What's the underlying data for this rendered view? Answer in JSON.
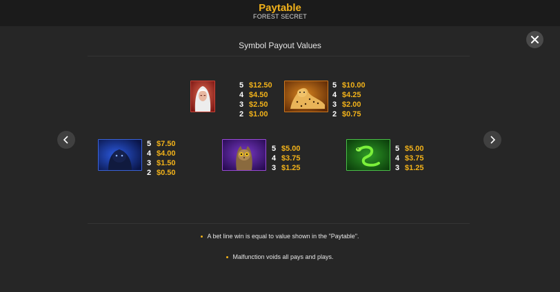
{
  "header": {
    "title": "Paytable",
    "subtitle": "FOREST SECRET"
  },
  "section_title": "Symbol Payout Values",
  "colors": {
    "accent": "#f2b21a",
    "background": "#262626",
    "header_bg": "#1b1b1b"
  },
  "icons": {
    "close": "close-icon",
    "prev": "chevron-left-icon",
    "next": "chevron-right-icon"
  },
  "symbols": [
    {
      "name": "woman-symbol",
      "pays": [
        {
          "count": "5",
          "amount": "$12.50"
        },
        {
          "count": "4",
          "amount": "$4.50"
        },
        {
          "count": "3",
          "amount": "$2.50"
        },
        {
          "count": "2",
          "amount": "$1.00"
        }
      ]
    },
    {
      "name": "cheetah-symbol",
      "pays": [
        {
          "count": "5",
          "amount": "$10.00"
        },
        {
          "count": "4",
          "amount": "$4.25"
        },
        {
          "count": "3",
          "amount": "$2.00"
        },
        {
          "count": "2",
          "amount": "$0.75"
        }
      ]
    },
    {
      "name": "panther-symbol",
      "pays": [
        {
          "count": "5",
          "amount": "$7.50"
        },
        {
          "count": "4",
          "amount": "$4.00"
        },
        {
          "count": "3",
          "amount": "$1.50"
        },
        {
          "count": "2",
          "amount": "$0.50"
        }
      ]
    },
    {
      "name": "owl-symbol",
      "pays": [
        {
          "count": "5",
          "amount": "$5.00"
        },
        {
          "count": "4",
          "amount": "$3.75"
        },
        {
          "count": "3",
          "amount": "$1.25"
        }
      ]
    },
    {
      "name": "snake-symbol",
      "pays": [
        {
          "count": "5",
          "amount": "$5.00"
        },
        {
          "count": "4",
          "amount": "$3.75"
        },
        {
          "count": "3",
          "amount": "$1.25"
        }
      ]
    }
  ],
  "rules": [
    "A bet line win is equal to value shown in the \"Paytable\".",
    "Malfunction voids all pays and plays."
  ]
}
